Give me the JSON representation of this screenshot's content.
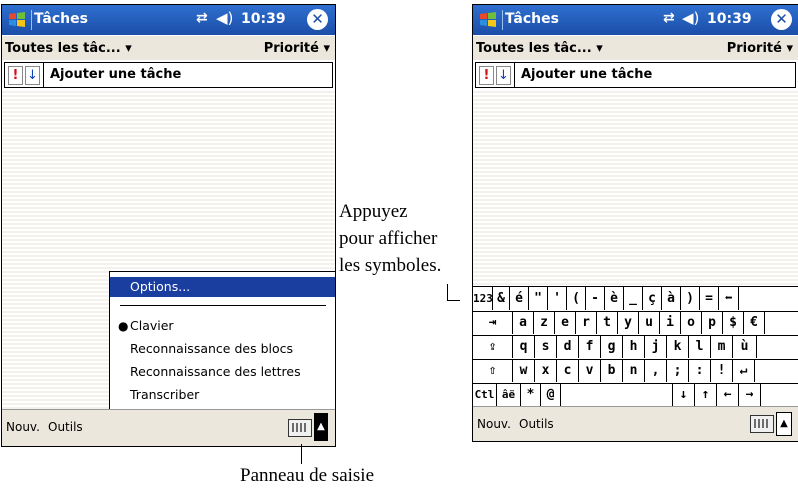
{
  "left_device": {
    "title_bar": {
      "app_title": "Tâches",
      "clock": "10:39",
      "close": "✕"
    },
    "filter_bar": {
      "filter": "Toutes les tâc...",
      "sort": "Priorité"
    },
    "entry_bar": {
      "prio_high": "!",
      "prio_low": "↓",
      "placeholder": "Ajouter une tâche"
    },
    "popup_menu": {
      "items": [
        "Options...",
        "Clavier",
        "Reconnaissance des blocs",
        "Reconnaissance des lettres",
        "Transcriber"
      ],
      "selected": "Options...",
      "checked": "Clavier"
    },
    "menu_bar": {
      "new": "Nouv.",
      "tools": "Outils",
      "sip_arrow": "▲"
    }
  },
  "right_device": {
    "title_bar": {
      "app_title": "Tâches",
      "clock": "10:39",
      "close": "✕"
    },
    "filter_bar": {
      "filter": "Toutes les tâc...",
      "sort": "Priorité"
    },
    "entry_bar": {
      "prio_high": "!",
      "prio_low": "↓",
      "placeholder": "Ajouter une tâche"
    },
    "keyboard_rows": [
      [
        "123",
        "&",
        "é",
        "\"",
        "'",
        "(",
        "-",
        "è",
        "_",
        "ç",
        "à",
        ")",
        "=",
        "⬅"
      ],
      [
        "⇥",
        "a",
        "z",
        "e",
        "r",
        "t",
        "y",
        "u",
        "i",
        "o",
        "p",
        "$",
        "€"
      ],
      [
        "⇪",
        "q",
        "s",
        "d",
        "f",
        "g",
        "h",
        "j",
        "k",
        "l",
        "m",
        "ù"
      ],
      [
        "⇧",
        "w",
        "x",
        "c",
        "v",
        "b",
        "n",
        ",",
        ";",
        ":",
        "!",
        "↵"
      ],
      [
        "Ctl",
        "âë",
        "*",
        "@",
        "",
        "↓",
        "↑",
        "←",
        "→"
      ]
    ],
    "menu_bar": {
      "new": "Nouv.",
      "tools": "Outils",
      "sip_arrow": "▲"
    }
  },
  "annotations": {
    "symbols_callout": [
      "Appuyez",
      "pour afficher",
      "les symboles."
    ],
    "input_panel_callout": "Panneau de saisie"
  },
  "colors": {
    "title_bar": "#1b4ea8",
    "selection": "#1a3ea0",
    "bar_bg": "#ece7dc"
  }
}
